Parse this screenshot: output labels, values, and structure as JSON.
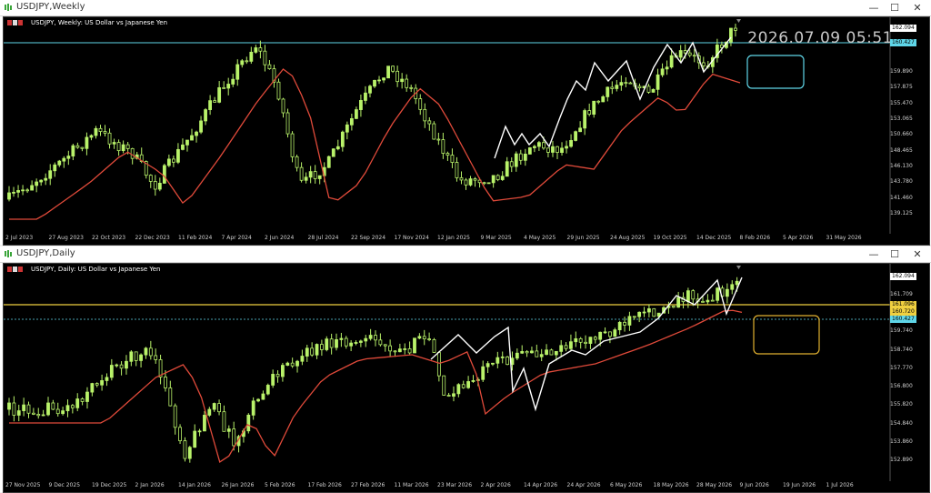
{
  "colors": {
    "bull": "#b9f26a",
    "ma": "#e04a3a",
    "zigzag": "#ffffff",
    "weekly_hline": "#5fd6e8",
    "daily_hline": "#f0d040",
    "daily_box": "#e0b030",
    "weekly_box": "#5fd6e8"
  },
  "weekly": {
    "window_title": "USDJPY,Weekly",
    "chart_label": "USDJPY, Weekly:  US Dollar vs Japanese Yen",
    "clock": "2026.07.09 05:51",
    "price_ticks": [
      "159.890",
      "157.875",
      "155.470",
      "153.065",
      "150.660",
      "148.465",
      "146.130",
      "143.780",
      "141.460",
      "139.125"
    ],
    "price_tags": [
      {
        "label": "162.094",
        "bg": "#ffffff",
        "fg": "#000000"
      },
      {
        "label": "160.427",
        "bg": "#5fd6e8",
        "fg": "#000000"
      }
    ],
    "time_ticks": [
      "2 Jul 2023",
      "27 Aug 2023",
      "22 Oct 2023",
      "22 Dec 2023",
      "11 Feb 2024",
      "7 Apr 2024",
      "2 Jun 2024",
      "28 Jul 2024",
      "22 Sep 2024",
      "17 Nov 2024",
      "12 Jan 2025",
      "9 Mar 2025",
      "4 May 2025",
      "29 Jun 2025",
      "24 Aug 2025",
      "19 Oct 2025",
      "14 Dec 2025",
      "8 Feb 2026",
      "5 Apr 2026",
      "31 May 2026"
    ]
  },
  "daily": {
    "window_title": "USDJPY,Daily",
    "chart_label": "USDJPY, Daily:  US Dollar vs Japanese Yen",
    "price_ticks": [
      "161.709",
      "160.740",
      "159.740",
      "158.740",
      "157.770",
      "156.800",
      "155.820",
      "154.840",
      "153.860",
      "152.890"
    ],
    "price_tags": [
      {
        "label": "162.094",
        "bg": "#ffffff",
        "fg": "#000000"
      },
      {
        "label": "161.096",
        "bg": "#f0d040",
        "fg": "#000000"
      },
      {
        "label": "160.720",
        "bg": "#f0d040",
        "fg": "#000000"
      },
      {
        "label": "160.427",
        "bg": "#5fd6e8",
        "fg": "#000000"
      }
    ],
    "time_ticks": [
      "27 Nov 2025",
      "9 Dec 2025",
      "19 Dec 2025",
      "2 Jan 2026",
      "14 Jan 2026",
      "26 Jan 2026",
      "5 Feb 2026",
      "17 Feb 2026",
      "27 Feb 2026",
      "11 Mar 2026",
      "23 Mar 2026",
      "2 Apr 2026",
      "14 Apr 2026",
      "24 Apr 2026",
      "6 May 2026",
      "18 May 2026",
      "28 May 2026",
      "9 Jun 2026",
      "19 Jun 2026",
      "1 Jul 2026"
    ]
  },
  "window_buttons": {
    "minimize": "—",
    "maximize": "☐",
    "close": "✕"
  }
}
